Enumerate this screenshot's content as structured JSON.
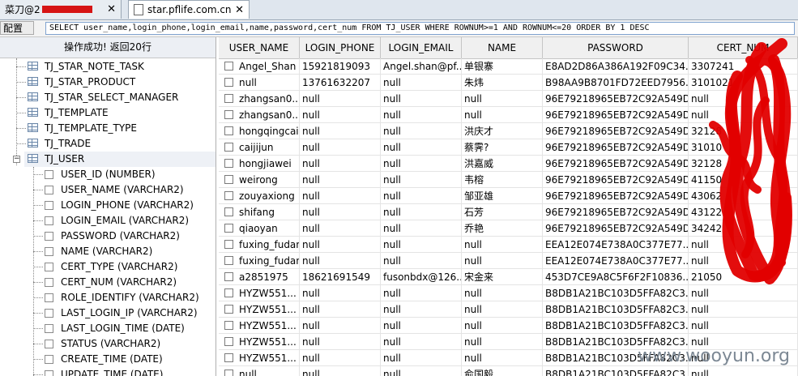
{
  "tabs": [
    {
      "label": "菜刀@2",
      "active": false
    },
    {
      "label": "star.pflife.com.cn",
      "active": true
    }
  ],
  "toolbar": {
    "config_label": "配置",
    "sql_query": "SELECT user_name,login_phone,login_email,name,password,cert_num FROM TJ_USER WHERE ROWNUM>=1 AND ROWNUM<=20 ORDER BY 1 DESC"
  },
  "left_panel": {
    "status": "操作成功! 返回20行",
    "tables": [
      "TJ_STAR_NOTE_TASK",
      "TJ_STAR_PRODUCT",
      "TJ_STAR_SELECT_MANAGER",
      "TJ_TEMPLATE",
      "TJ_TEMPLATE_TYPE",
      "TJ_TRADE"
    ],
    "expanded_table": "TJ_USER",
    "columns": [
      "USER_ID (NUMBER)",
      "USER_NAME (VARCHAR2)",
      "LOGIN_PHONE (VARCHAR2)",
      "LOGIN_EMAIL (VARCHAR2)",
      "PASSWORD (VARCHAR2)",
      "NAME (VARCHAR2)",
      "CERT_TYPE (VARCHAR2)",
      "CERT_NUM (VARCHAR2)",
      "ROLE_IDENTIFY (VARCHAR2)",
      "LAST_LOGIN_IP (VARCHAR2)",
      "LAST_LOGIN_TIME (DATE)",
      "STATUS (VARCHAR2)",
      "CREATE_TIME (DATE)",
      "UPDATE_TIME (DATE)"
    ]
  },
  "grid": {
    "headers": [
      "USER_NAME",
      "LOGIN_PHONE",
      "LOGIN_EMAIL",
      "NAME",
      "PASSWORD",
      "CERT_NUM"
    ],
    "rows": [
      [
        "Angel_Shan",
        "15921819093",
        "Angel.shan@pf...",
        "单银寨",
        "E8AD2D86A386A192F09C34...",
        "3307241"
      ],
      [
        "null",
        "13761632207",
        "null",
        "朱炜",
        "B98AA9B8701FD72EED7956...",
        "3101021"
      ],
      [
        "zhangsan0...",
        "null",
        "null",
        "null",
        "96E79218965EB72C92A549D...",
        "null"
      ],
      [
        "zhangsan0...",
        "null",
        "null",
        "null",
        "96E79218965EB72C92A549D...",
        "null"
      ],
      [
        "hongqingcai",
        "null",
        "null",
        "洪庆才",
        "96E79218965EB72C92A549D...",
        "32128"
      ],
      [
        "caijijun",
        "null",
        "null",
        "蔡霁?",
        "96E79218965EB72C92A549D...",
        "31010"
      ],
      [
        "hongjiawei",
        "null",
        "null",
        "洪嘉威",
        "96E79218965EB72C92A549D...",
        "32128"
      ],
      [
        "weirong",
        "null",
        "null",
        "韦榕",
        "96E79218965EB72C92A549D...",
        "41150"
      ],
      [
        "zouyaxiong",
        "null",
        "null",
        "邹亚雄",
        "96E79218965EB72C92A549D...",
        "43062"
      ],
      [
        "shifang",
        "null",
        "null",
        "石芳",
        "96E79218965EB72C92A549D...",
        "43122"
      ],
      [
        "qiaoyan",
        "null",
        "null",
        "乔艳",
        "96E79218965EB72C92A549D...",
        "34242"
      ],
      [
        "fuxing_fudan",
        "null",
        "null",
        "null",
        "EEA12E074E738A0C377E77...",
        "null"
      ],
      [
        "fuxing_fudan",
        "null",
        "null",
        "null",
        "EEA12E074E738A0C377E77...",
        "null"
      ],
      [
        "a2851975",
        "18621691549",
        "fusonbdx@126....",
        "宋金来",
        "453D7CE9A8C5F6F2F10836...",
        "21050"
      ],
      [
        "HYZW551...",
        "null",
        "null",
        "null",
        "B8DB1A21BC103D5FFA82C3...",
        "null"
      ],
      [
        "HYZW551...",
        "null",
        "null",
        "null",
        "B8DB1A21BC103D5FFA82C3...",
        "null"
      ],
      [
        "HYZW551...",
        "null",
        "null",
        "null",
        "B8DB1A21BC103D5FFA82C3...",
        "null"
      ],
      [
        "HYZW551...",
        "null",
        "null",
        "null",
        "B8DB1A21BC103D5FFA82C3...",
        "null"
      ],
      [
        "HYZW551...",
        "null",
        "null",
        "null",
        "B8DB1A21BC103D5FFA82C3...",
        "null"
      ],
      [
        "null",
        "null",
        "null",
        "俞国毅",
        "B8DB1A21BC103D5FFA82C3...",
        "null"
      ]
    ]
  },
  "watermark": "www.wooyun.org",
  "colors": {
    "redaction": "#e10000",
    "selection": "#eef1f6"
  }
}
